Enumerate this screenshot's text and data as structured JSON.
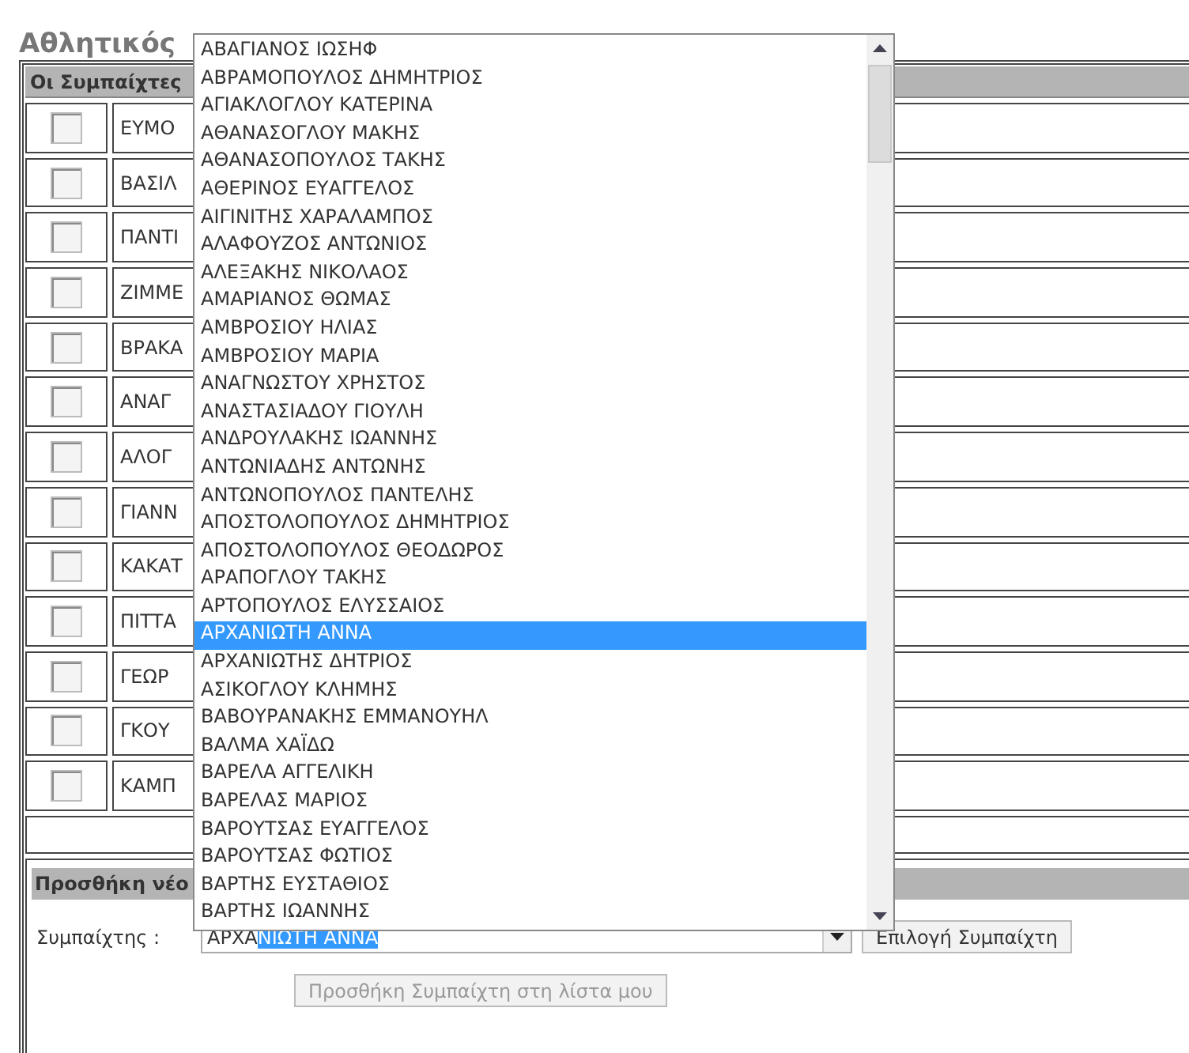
{
  "title": "Αθλητικός",
  "teammates": {
    "header": "Οι Συμπαίχτες",
    "rows": [
      {
        "name": "ΕΥΜΟ",
        "checked": false
      },
      {
        "name": "ΒΑΣΙΛ",
        "checked": false
      },
      {
        "name": "ΠΑΝΤΙ",
        "checked": false
      },
      {
        "name": "ΖΙΜΜΕ",
        "checked": false
      },
      {
        "name": "ΒΡΑΚΑ",
        "checked": false
      },
      {
        "name": "ΑΝΑΓ",
        "checked": false
      },
      {
        "name": "ΑΛΟΓ",
        "checked": false
      },
      {
        "name": "ΓΙΑΝΝ",
        "checked": false
      },
      {
        "name": "ΚΑΚΑΤ",
        "checked": false
      },
      {
        "name": "ΠΙΤΤΑ",
        "checked": false
      },
      {
        "name": "ΓΕΩΡ",
        "checked": false
      },
      {
        "name": "ΓΚΟΥ",
        "checked": false
      },
      {
        "name": "ΚΑΜΠ",
        "checked": false
      }
    ]
  },
  "add_section": {
    "header": "Προσθήκη νέο",
    "label": "Συμπαίχτης :",
    "combobox": {
      "typed": "ΑΡΧΑ",
      "completion": "ΝΙΩΤΗ ΑΝΝΑ"
    },
    "select_button": "Επιλογή Συμπαίχτη",
    "add_button": {
      "label": "Προσθήκη Συμπαίχτη στη λίστα μου",
      "disabled": true
    }
  },
  "dropdown": [
    {
      "label": "ΑΒΑΓΙΑΝΟΣ ΙΩΣΗΦ",
      "selected": false
    },
    {
      "label": "ΑΒΡΑΜΟΠΟΥΛΟΣ ΔΗΜΗΤΡΙΟΣ",
      "selected": false
    },
    {
      "label": "ΑΓΙΑΚΛΟΓΛΟΥ ΚΑΤΕΡΙΝΑ",
      "selected": false
    },
    {
      "label": "ΑΘΑΝΑΣΟΓΛΟΥ ΜΑΚΗΣ",
      "selected": false
    },
    {
      "label": "ΑΘΑΝΑΣΟΠΟΥΛΟΣ ΤΑΚΗΣ",
      "selected": false
    },
    {
      "label": "ΑΘΕΡΙΝΟΣ ΕΥΑΓΓΕΛΟΣ",
      "selected": false
    },
    {
      "label": "ΑΙΓΙΝΙΤΗΣ ΧΑΡΑΛΑΜΠΟΣ",
      "selected": false
    },
    {
      "label": "ΑΛΑΦΟΥΖΟΣ ΑΝΤΩΝΙΟΣ",
      "selected": false
    },
    {
      "label": "ΑΛΕΞΑΚΗΣ ΝΙΚΟΛΑΟΣ",
      "selected": false
    },
    {
      "label": "ΑΜΑΡΙΑΝΟΣ ΘΩΜΑΣ",
      "selected": false
    },
    {
      "label": "ΑΜΒΡΟΣΙΟΥ ΗΛΙΑΣ",
      "selected": false
    },
    {
      "label": "ΑΜΒΡΟΣΙΟΥ ΜΑΡΙΑ",
      "selected": false
    },
    {
      "label": "ΑΝΑΓΝΩΣΤΟΥ ΧΡΗΣΤΟΣ",
      "selected": false
    },
    {
      "label": "ΑΝΑΣΤΑΣΙΑΔΟΥ ΓΙΟΥΛΗ",
      "selected": false
    },
    {
      "label": "ΑΝΔΡΟΥΛΑΚΗΣ ΙΩΑΝΝΗΣ",
      "selected": false
    },
    {
      "label": "ΑΝΤΩΝΙΑΔΗΣ ΑΝΤΩΝΗΣ",
      "selected": false
    },
    {
      "label": "ΑΝΤΩΝΟΠΟΥΛΟΣ ΠΑΝΤΕΛΗΣ",
      "selected": false
    },
    {
      "label": "ΑΠΟΣΤΟΛΟΠΟΥΛΟΣ ΔΗΜΗΤΡΙΟΣ",
      "selected": false
    },
    {
      "label": "ΑΠΟΣΤΟΛΟΠΟΥΛΟΣ ΘΕΟΔΩΡΟΣ",
      "selected": false
    },
    {
      "label": "ΑΡΑΠΟΓΛΟΥ ΤΑΚΗΣ",
      "selected": false
    },
    {
      "label": "ΑΡΤΟΠΟΥΛΟΣ ΕΛΥΣΣΑΙΟΣ",
      "selected": false
    },
    {
      "label": "ΑΡΧΑΝΙΩΤΗ ΑΝΝΑ",
      "selected": true
    },
    {
      "label": "ΑΡΧΑΝΙΩΤΗΣ ΔΗΤΡΙΟΣ",
      "selected": false
    },
    {
      "label": "ΑΣΙΚΟΓΛΟΥ ΚΛΗΜΗΣ",
      "selected": false
    },
    {
      "label": "ΒΑΒΟΥΡΑΝΑΚΗΣ ΕΜΜΑΝΟΥΗΛ",
      "selected": false
    },
    {
      "label": "ΒΑΛΜΑ ΧΑΪΔΩ",
      "selected": false
    },
    {
      "label": "ΒΑΡΕΛΑ ΑΓΓΕΛΙΚΗ",
      "selected": false
    },
    {
      "label": "ΒΑΡΕΛΑΣ ΜΑΡΙΟΣ",
      "selected": false
    },
    {
      "label": "ΒΑΡΟΥΤΣΑΣ ΕΥΑΓΓΕΛΟΣ",
      "selected": false
    },
    {
      "label": "ΒΑΡΟΥΤΣΑΣ ΦΩΤΙΟΣ",
      "selected": false
    },
    {
      "label": "ΒΑΡΤΗΣ ΕΥΣΤΑΘΙΟΣ",
      "selected": false
    },
    {
      "label": "ΒΑΡΤΗΣ ΙΩΑΝΝΗΣ",
      "selected": false
    }
  ]
}
